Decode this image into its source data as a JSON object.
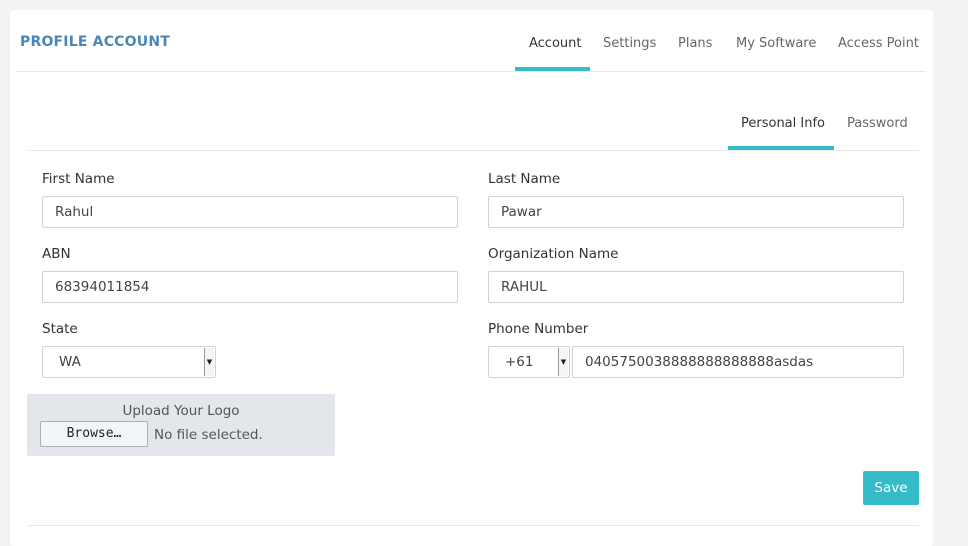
{
  "header": {
    "title": "PROFILE ACCOUNT",
    "tabs": [
      "Account",
      "Settings",
      "Plans",
      "My Software",
      "Access Point"
    ],
    "active_tab": "Account"
  },
  "subtabs": {
    "items": [
      "Personal Info",
      "Password"
    ],
    "active": "Personal Info"
  },
  "form": {
    "first_name": {
      "label": "First Name",
      "value": "Rahul"
    },
    "last_name": {
      "label": "Last Name",
      "value": "Pawar"
    },
    "abn": {
      "label": "ABN",
      "value": "68394011854"
    },
    "organization": {
      "label": "Organization Name",
      "value": "RAHUL"
    },
    "state": {
      "label": "State",
      "value": "WA"
    },
    "phone": {
      "label": "Phone Number",
      "code": "+61",
      "value": "0405750038888888888888asdas"
    },
    "upload": {
      "title": "Upload Your Logo",
      "button": "Browse…",
      "status": "No file selected."
    },
    "save_label": "Save"
  },
  "colors": {
    "accent": "#35bcc8",
    "title": "#4a86b8"
  }
}
